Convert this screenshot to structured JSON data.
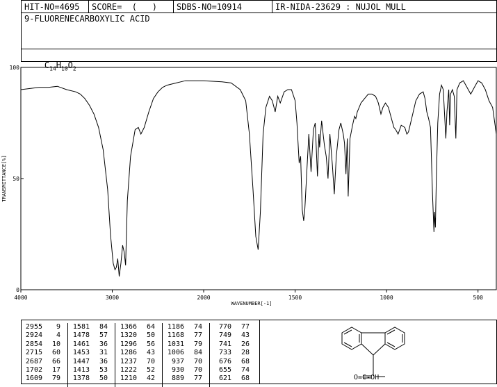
{
  "header": {
    "hit_no": "HIT-NO=4695",
    "score": "SCORE=  (   )",
    "sdbs_no": "SDBS-NO=10914",
    "ir_id": "IR-NIDA-23629 : NUJOL MULL",
    "compound_name": "9-FLUORENECARBOXYLIC ACID",
    "formula": {
      "c": "C",
      "c_n": "14",
      "h": "H",
      "h_n": "10",
      "o": "O",
      "o_n": "2"
    }
  },
  "chart_data": {
    "type": "line",
    "title": "",
    "xlabel": "WAVENUMBER[-1]",
    "ylabel": "TRANSMITTANCE[%]",
    "xlim": [
      4000,
      400
    ],
    "ylim": [
      0,
      100
    ],
    "x_ticks": [
      "4000",
      "3000",
      "2000",
      "1500",
      "1000",
      "500"
    ],
    "x_tick_values": [
      4000,
      3000,
      2000,
      1500,
      1000,
      500
    ],
    "y_ticks": [
      "0",
      "50",
      "100"
    ],
    "y_tick_values": [
      0,
      50,
      100
    ],
    "series": [
      {
        "x": [
          4000,
          3900,
          3800,
          3700,
          3600,
          3500,
          3400,
          3350,
          3300,
          3250,
          3200,
          3150,
          3100,
          3050,
          3020,
          2990,
          2970,
          2956,
          2940,
          2924,
          2905,
          2887,
          2870,
          2854,
          2835,
          2800,
          2750,
          2715,
          2687,
          2650,
          2600,
          2550,
          2500,
          2450,
          2400,
          2300,
          2200,
          2100,
          2000,
          1900,
          1850,
          1800,
          1770,
          1750,
          1730,
          1715,
          1702,
          1690,
          1675,
          1660,
          1640,
          1625,
          1609,
          1595,
          1581,
          1560,
          1540,
          1520,
          1500,
          1490,
          1478,
          1470,
          1461,
          1453,
          1447,
          1435,
          1425,
          1413,
          1400,
          1390,
          1378,
          1370,
          1366,
          1355,
          1340,
          1330,
          1320,
          1310,
          1296,
          1286,
          1275,
          1260,
          1250,
          1237,
          1230,
          1222,
          1215,
          1210,
          1200,
          1186,
          1175,
          1168,
          1160,
          1150,
          1140,
          1130,
          1120,
          1110,
          1100,
          1080,
          1060,
          1045,
          1031,
          1020,
          1006,
          990,
          970,
          960,
          950,
          937,
          920,
          900,
          889,
          880,
          860,
          840,
          820,
          800,
          790,
          780,
          770,
          760,
          755,
          749,
          745,
          741,
          738,
          733,
          728,
          720,
          710,
          700,
          690,
          676,
          670,
          660,
          655,
          650,
          640,
          630,
          621,
          615,
          600,
          580,
          560,
          540,
          520,
          500,
          480,
          460,
          440,
          420,
          400
        ],
        "y": [
          90,
          90.5,
          91,
          91,
          91.5,
          90,
          89,
          88,
          86,
          83,
          79,
          73,
          63,
          45,
          25,
          12,
          9,
          10,
          14,
          6,
          12,
          20,
          17,
          11,
          40,
          60,
          72,
          73,
          70,
          73,
          80,
          86,
          89,
          91,
          92,
          93,
          94,
          94,
          94,
          93.5,
          93,
          90,
          85,
          70,
          45,
          24,
          18,
          35,
          70,
          82,
          87,
          85,
          80,
          87,
          84,
          89,
          90,
          90,
          85,
          75,
          57,
          60,
          36,
          31,
          36,
          55,
          70,
          53,
          72,
          75,
          51,
          70,
          64,
          76,
          65,
          60,
          50,
          70,
          56,
          43,
          60,
          72,
          75,
          70,
          66,
          52,
          68,
          42,
          68,
          74,
          78,
          77,
          80,
          82,
          84,
          85,
          86,
          87,
          88,
          88,
          87,
          84,
          79,
          82,
          84,
          82,
          76,
          73,
          72,
          70,
          74,
          73,
          70,
          71,
          78,
          85,
          88,
          89,
          86,
          80,
          77,
          73,
          60,
          43,
          35,
          26,
          35,
          28,
          50,
          75,
          88,
          92,
          90,
          68,
          80,
          90,
          74,
          88,
          90,
          87,
          68,
          90,
          93,
          94,
          91,
          88,
          91,
          94,
          93,
          90,
          85,
          82,
          70
        ]
      }
    ],
    "peaks": [
      [
        {
          "wn": "2955",
          "t": "9"
        },
        {
          "wn": "2924",
          "t": "4"
        },
        {
          "wn": "2854",
          "t": "10"
        },
        {
          "wn": "2715",
          "t": "60"
        },
        {
          "wn": "2687",
          "t": "66"
        },
        {
          "wn": "1702",
          "t": "17"
        },
        {
          "wn": "1609",
          "t": "79"
        }
      ],
      [
        {
          "wn": "1581",
          "t": "84"
        },
        {
          "wn": "1478",
          "t": "57"
        },
        {
          "wn": "1461",
          "t": "36"
        },
        {
          "wn": "1453",
          "t": "31"
        },
        {
          "wn": "1447",
          "t": "36"
        },
        {
          "wn": "1413",
          "t": "53"
        },
        {
          "wn": "1378",
          "t": "50"
        }
      ],
      [
        {
          "wn": "1366",
          "t": "64"
        },
        {
          "wn": "1320",
          "t": "50"
        },
        {
          "wn": "1296",
          "t": "56"
        },
        {
          "wn": "1286",
          "t": "43"
        },
        {
          "wn": "1237",
          "t": "70"
        },
        {
          "wn": "1222",
          "t": "52"
        },
        {
          "wn": "1210",
          "t": "42"
        }
      ],
      [
        {
          "wn": "1186",
          "t": "74"
        },
        {
          "wn": "1168",
          "t": "77"
        },
        {
          "wn": "1031",
          "t": "79"
        },
        {
          "wn": "1006",
          "t": "84"
        },
        {
          "wn": "937",
          "t": "70"
        },
        {
          "wn": "930",
          "t": "70"
        },
        {
          "wn": "889",
          "t": "77"
        }
      ],
      [
        {
          "wn": "770",
          "t": "77"
        },
        {
          "wn": "749",
          "t": "43"
        },
        {
          "wn": "741",
          "t": "26"
        },
        {
          "wn": "733",
          "t": "28"
        },
        {
          "wn": "676",
          "t": "68"
        },
        {
          "wn": "655",
          "t": "74"
        },
        {
          "wn": "621",
          "t": "68"
        }
      ]
    ]
  },
  "structure": {
    "group_label": "O=C-OH"
  }
}
